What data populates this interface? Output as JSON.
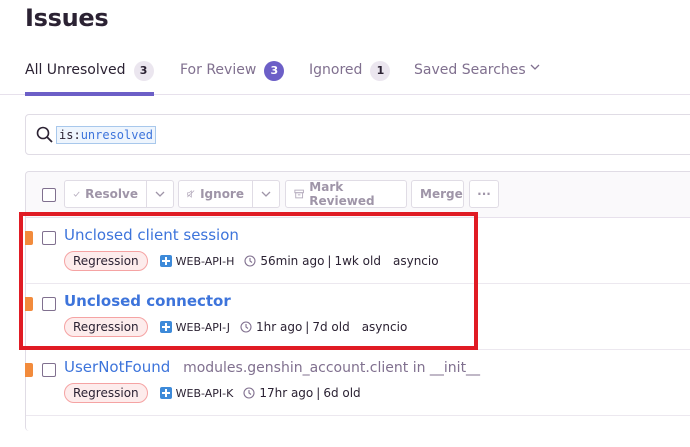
{
  "page": {
    "title": "Issues"
  },
  "tabs": [
    {
      "label": "All Unresolved",
      "count": "3",
      "active": true
    },
    {
      "label": "For Review",
      "count": "3"
    },
    {
      "label": "Ignored",
      "count": "1"
    },
    {
      "label": "Saved Searches"
    }
  ],
  "search": {
    "token_key": "is:",
    "token_value": "unresolved"
  },
  "toolbar": {
    "resolve_label": "Resolve",
    "ignore_label": "Ignore",
    "mark_reviewed_label": "Mark Reviewed",
    "merge_label": "Merge",
    "more_label": "···"
  },
  "issues": [
    {
      "title": "Unclosed client session",
      "culprit": "",
      "tag": "Regression",
      "project": "WEB-API-H",
      "last_seen": "56min ago",
      "age": "1wk old",
      "logger": "asyncio"
    },
    {
      "title": "Unclosed connector",
      "culprit": "",
      "tag": "Regression",
      "project": "WEB-API-J",
      "last_seen": "1hr ago",
      "age": "7d old",
      "logger": "asyncio"
    },
    {
      "title": "UserNotFound",
      "culprit": "modules.genshin_account.client in __init__",
      "tag": "Regression",
      "project": "WEB-API-K",
      "last_seen": "17hr ago",
      "age": "6d old",
      "logger": ""
    }
  ],
  "colors": {
    "accent": "#6c5fc7",
    "link": "#3d74db",
    "level_warning": "#f28b3c",
    "highlight_box": "#e01b24"
  },
  "icons": [
    "search-icon",
    "check-icon",
    "mute-icon",
    "archive-icon",
    "chevron-down-icon",
    "clock-icon",
    "project-icon"
  ]
}
